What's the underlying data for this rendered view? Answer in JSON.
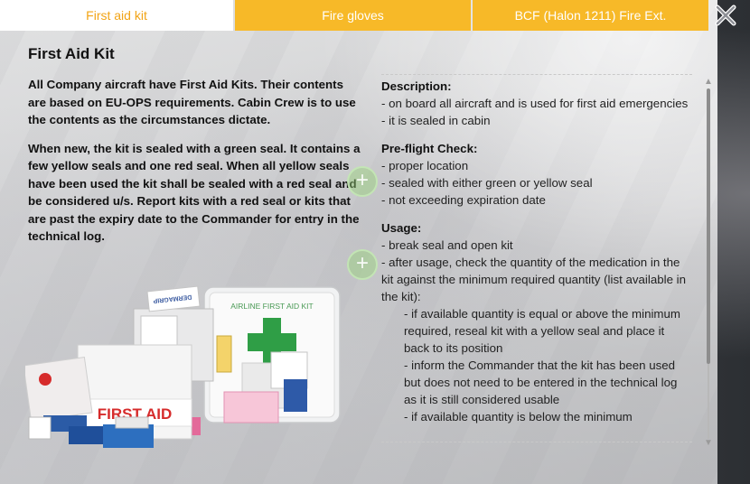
{
  "tabs": [
    {
      "label": "First aid kit",
      "active": true
    },
    {
      "label": "Fire gloves",
      "active": false
    },
    {
      "label": "BCF (Halon 1211) Fire Ext.",
      "active": false
    }
  ],
  "title": "First Aid Kit",
  "intro": [
    "All Company aircraft have First Aid Kits. Their contents are based on EU-OPS requirements. Cabin Crew is to use the contents as the circumstances dictate.",
    "When new, the kit is sealed with a green seal. It contains a few yellow seals and one red seal. When all yellow seals have been used the kit shall be sealed with a red seal and be considered u/s. Report kits with a red seal or kits that are past the expiry date to the Commander for entry in the technical log."
  ],
  "details": {
    "description_heading": "Description:",
    "description": [
      "- on board all aircraft and is used for first aid emergencies",
      "- it is sealed in cabin"
    ],
    "preflight_heading": "Pre-flight Check:",
    "preflight": [
      "- proper location",
      "- sealed with either green or yellow seal",
      "- not exceeding expiration date"
    ],
    "usage_heading": "Usage:",
    "usage": [
      "- break seal and open kit",
      "- after usage, check the quantity of the medication in the kit against the minimum required quantity (list available in the kit):"
    ],
    "usage_sub": [
      "- if available quantity is equal or above the minimum required, reseal kit with a yellow seal and place it back to its position",
      "- inform the Commander that the kit has been used but does not need to be entered in the technical log as it is still considered usable",
      "- if available quantity is below the minimum"
    ]
  },
  "illustration": {
    "box_label": "AIRLINE FIRST AID KIT",
    "bag_label": "FIRST AID",
    "pack_label": "DERMAGRIP",
    "colors": {
      "accent": "#f7b928",
      "active_tab_text": "#f2a416",
      "cross_green": "#2f9e46",
      "bag_red": "#d62b2b"
    }
  },
  "icons": {
    "close": "close-icon",
    "plus": "plus-icon",
    "scroll_up": "arrow-up-icon",
    "scroll_down": "arrow-down-icon"
  }
}
